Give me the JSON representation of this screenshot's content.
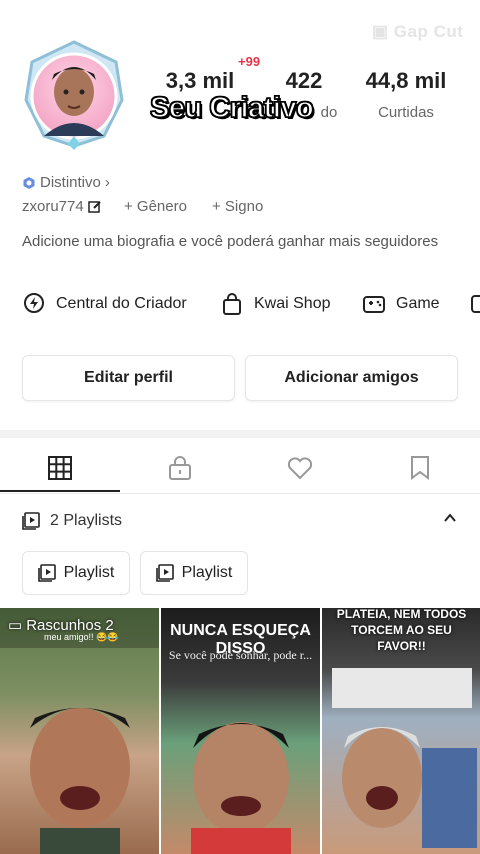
{
  "watermark": "Gap Cut",
  "badge": "+99",
  "overlay": "Seu Criativo",
  "stats": [
    {
      "value": "3,3 mil",
      "label": ""
    },
    {
      "value": "422",
      "label": "do"
    },
    {
      "value": "44,8 mil",
      "label": "Curtidas"
    }
  ],
  "distintivo": "Distintivo",
  "username": "zxoru774",
  "genero": "+ Gênero",
  "signo": "+ Signo",
  "bio": "Adicione uma biografia e você poderá ganhar mais seguidores",
  "shortcuts": [
    {
      "label": "Central do Criador",
      "icon": "bolt-icon"
    },
    {
      "label": "Kwai Shop",
      "icon": "shopping-bag-icon"
    },
    {
      "label": "Game",
      "icon": "gamepad-icon"
    }
  ],
  "buttons": {
    "edit": "Editar perfil",
    "add": "Adicionar amigos"
  },
  "playlists": {
    "count_label": "2 Playlists",
    "items": [
      "Playlist",
      "Playlist"
    ]
  },
  "videos": [
    {
      "caption": "Rascunhos 2",
      "subtext": "meu amigo!! 😂😂"
    },
    {
      "caption": "NUNCA ESQUEÇA DISSO",
      "subtext": "Se você pode sonhar, pode r..."
    },
    {
      "caption": "PLATEIA, NEM TODOS TORCEM AO SEU FAVOR!!",
      "subtext": ""
    }
  ],
  "colors": {
    "accent": "#e8334a",
    "border": "#e6e6e6",
    "text": "#222222"
  }
}
